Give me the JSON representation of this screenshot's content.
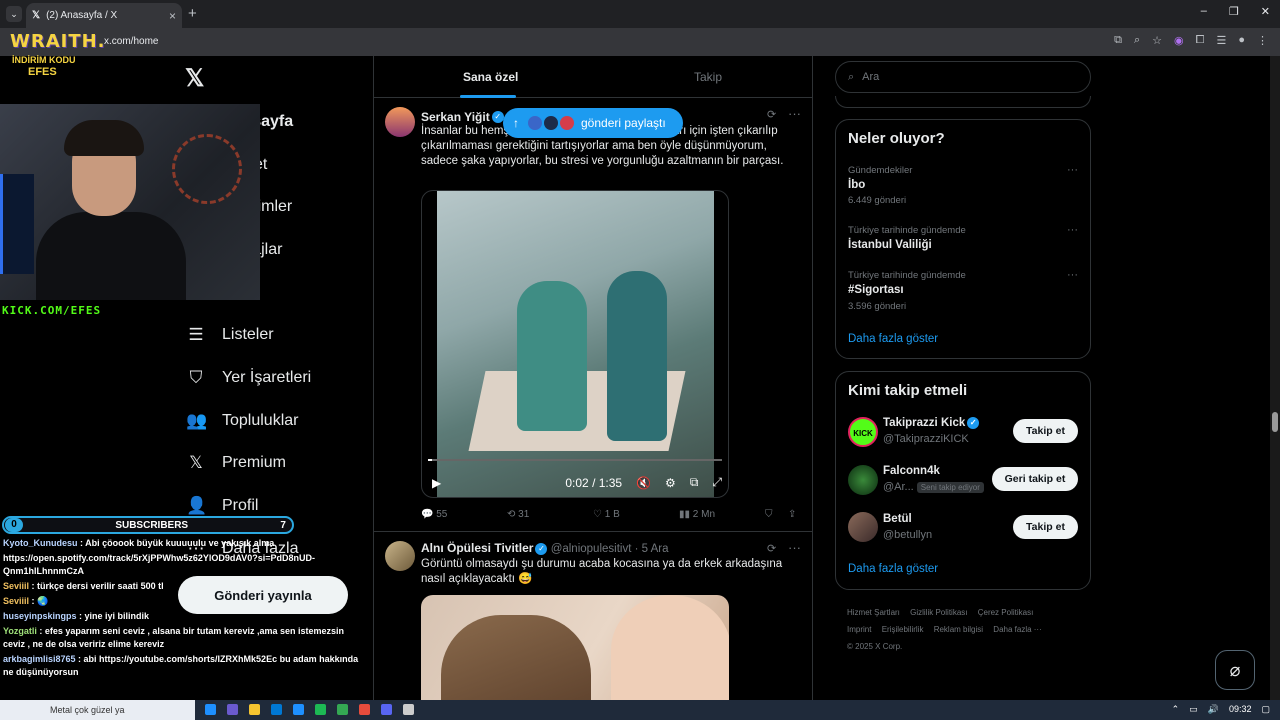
{
  "browser": {
    "tab_title": "(2) Anasayfa / X",
    "tab_close": "×",
    "new_tab": "+",
    "url": "x.com/home",
    "window_controls": [
      "–",
      "❐",
      "✕"
    ]
  },
  "stream_overlay": {
    "brand": "WRAITH.",
    "promo_line1": "İNDİRİM KODU",
    "promo_line2": "EFES",
    "kick_url": "KICK.COM/EFES",
    "subscribers_label": "SUBSCRIBERS",
    "subscribers_left": "0",
    "subscribers_right": "7",
    "chat": [
      {
        "user": "Kyoto_Kunudesu",
        "text": " : Abi çöoook büyük kuuuuulu ve yakışık alma"
      },
      {
        "user": "",
        "text": "https://open.spotify.com/track/5rXjPPWhw5z62YlOD9dAV0?si=PdD8nUD-Qnm1hlLhnnmCzA"
      },
      {
        "user": "Seviiil",
        "text": " : türkçe dersi verilir saati 500 tl"
      },
      {
        "user": "Seviiil",
        "text": " : 🌏"
      },
      {
        "user": "huseyinpskingps",
        "text": " : yine iyi bilindik"
      },
      {
        "user": "Yozgatli",
        "text": " : efes yaparım seni ceviz , alsana bir tutam kereviz ,ama sen istemezsin ceviz , ne de olsa veririz elime kereviz"
      },
      {
        "user": "arkbagimlisi8765",
        "text": " : abi https://youtube.com/shorts/IZRXhMk52Ec bu adam hakkında ne düşünüyorsun"
      }
    ]
  },
  "left_nav": {
    "items": [
      {
        "label": "Anasayfa",
        "icon": "home-icon"
      },
      {
        "label": "Keşfet",
        "icon": "search-icon"
      },
      {
        "label": "Bildirimler",
        "icon": "bell-icon"
      },
      {
        "label": "Mesajlar",
        "icon": "mail-icon"
      },
      {
        "label": "Listeler",
        "icon": "list-icon"
      },
      {
        "label": "Yer İşaretleri",
        "icon": "bookmark-icon"
      },
      {
        "label": "Topluluklar",
        "icon": "community-icon"
      },
      {
        "label": "Premium",
        "icon": "x-logo-icon"
      },
      {
        "label": "Profil",
        "icon": "person-icon"
      },
      {
        "label": "Daha fazla",
        "icon": "more-circle-icon"
      }
    ],
    "post_button": "Gönderi yayınla"
  },
  "feed": {
    "tabs": [
      "Sana özel",
      "Takip"
    ],
    "share_pill": "gönderi paylaştı",
    "tweets": [
      {
        "name": "Serkan Yiğit",
        "text": "İnsanlar bu hemşirelerin yaptıkları şaka ve yaptıkları için işten çıkarılıp çıkarılmaması gerektiğini tartışıyorlar ama ben öyle düşünmüyorum, sadece şaka yapıyorlar, bu stresi ve yorgunluğu azaltmanın bir parçası.",
        "video_time": "0:02 / 1:35",
        "replies": "55",
        "reposts": "31",
        "likes": "1 B",
        "views": "2 Mn"
      },
      {
        "name": "Alnı Öpülesi Tivitler",
        "handle": "@alniopulesitivt",
        "time": "· 5 Ara",
        "text": "Görüntü olmasaydı şu durumu acaba kocasına ya da erkek arkadaşına nasıl açıklayacaktı 😅"
      }
    ]
  },
  "sidebar": {
    "search_placeholder": "Ara",
    "trends_title": "Neler oluyor?",
    "trends": [
      {
        "meta": "Gündemdekiler",
        "name": "İbo",
        "count": "6.449 gönderi"
      },
      {
        "meta": "Türkiye tarihinde gündemde",
        "name": "İstanbul Valiliği",
        "count": ""
      },
      {
        "meta": "Türkiye tarihinde gündemde",
        "name": "#Sigortası",
        "count": "3.596 gönderi"
      }
    ],
    "trends_more": "Daha fazla göster",
    "wtf_title": "Kimi takip etmeli",
    "wtf": [
      {
        "name": "Takiprazzi Kick",
        "handle": "@TakiprazziKICK",
        "button": "Takip et",
        "badge": ""
      },
      {
        "name": "Falconn4k",
        "handle": "@Ar...",
        "button": "Geri takip et",
        "badge": "Seni takip ediyor"
      },
      {
        "name": "Betül",
        "handle": "@betullyn",
        "button": "Takip et",
        "badge": ""
      }
    ],
    "wtf_more": "Daha fazla göster",
    "footer_links": [
      "Hizmet Şartları",
      "Gizlilik Politikası",
      "Çerez Politikası",
      "Imprint",
      "Erişilebilirlik",
      "Reklam bilgisi",
      "Daha fazla ···"
    ],
    "copyright": "© 2025 X Corp."
  },
  "taskbar": {
    "search_text": "Metal çok güzel ya",
    "clock": "09:32"
  },
  "colors": {
    "accent": "#1d9bf0",
    "kick_green": "#53fc18",
    "brand_yellow": "#f5d442"
  }
}
